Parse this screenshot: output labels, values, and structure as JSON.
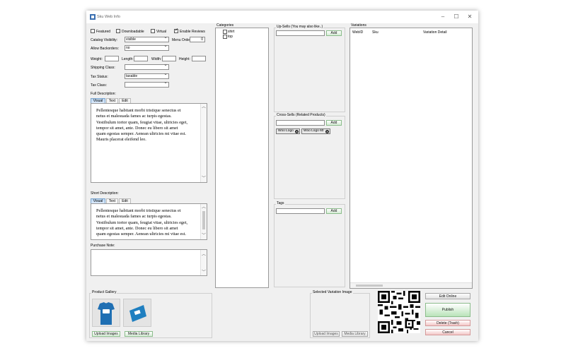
{
  "window": {
    "title": "Sku Web Info",
    "controls": {
      "minimize": "–",
      "maximize": "☐",
      "close": "✕"
    }
  },
  "general": {
    "featured_label": "Featured",
    "featured_checked": false,
    "downloadable_label": "Downloadable",
    "downloadable_checked": false,
    "virtual_label": "Virtual",
    "virtual_checked": false,
    "enable_reviews_label": "Enable Reviews",
    "enable_reviews_checked": true,
    "catalog_visibility_label": "Catalog Visibility:",
    "catalog_visibility_value": "visible",
    "menu_order_label": "Menu Order:",
    "menu_order_value": "0",
    "allow_backorders_label": "Allow Backorders:",
    "allow_backorders_value": "no",
    "weight_label": "Weight:",
    "length_label": "Length:",
    "width_label": "Width:",
    "height_label": "Height:",
    "shipping_class_label": "Shipping Class:",
    "shipping_class_value": "",
    "tax_status_label": "Tax Status:",
    "tax_status_value": "taxable",
    "tax_class_label": "Tax Class:",
    "tax_class_value": ""
  },
  "full_description": {
    "label": "Full Description:",
    "tabs": [
      "Visual",
      "Text",
      "Edit"
    ],
    "lines": [
      "Pellentesque habitant morbi tristique senectus et",
      "netus et malesuada fames ac turpis egestas.",
      "Vestibulum tortor quam, feugiat vitae, ultricies eget,",
      "tempor sit amet, ante. Donec eu libero sit amet",
      "quam egestas semper. Aenean ultricies mi vitae est.",
      "Mauris placerat eleifend leo."
    ]
  },
  "short_description": {
    "label": "Short Description:",
    "tabs": [
      "Visual",
      "Text",
      "Edit"
    ],
    "lines": [
      "Pellentesque habitant morbi tristique senectus et",
      "netus et malesuada fames ac turpis egestas.",
      "Vestibulum tortor quam, feugiat vitae, ultricies eget,",
      "tempor sit amet, ante. Donec eu libero sit amet",
      "quam egestas semper. Aenean ultricies mi vitae est."
    ]
  },
  "purchase_note": {
    "label": "Purchase Note:"
  },
  "categories": {
    "title": "Categories",
    "items": [
      {
        "label": "shirt",
        "checked": false
      },
      {
        "label": "top",
        "checked": false
      }
    ]
  },
  "upsells": {
    "title": "Up-Sells (You may also like..)",
    "add_label": "Add"
  },
  "crosssells": {
    "title": "Cross-Sells (Related Products)",
    "add_label": "Add",
    "tags": [
      {
        "label": "Woo Logo"
      },
      {
        "label": "Woo Logo 60"
      }
    ]
  },
  "tags_group": {
    "title": "Tags",
    "add_label": "Add"
  },
  "variations": {
    "title": "Variations",
    "columns": [
      "WebID",
      "Sku",
      "Variation Detail"
    ]
  },
  "gallery": {
    "title": "Product Gallery",
    "upload_label": "Upload Images",
    "media_label": "Media Library"
  },
  "variation_image": {
    "title": "Selected Variation Image",
    "upload_label": "Upload Images",
    "media_label": "Media Library"
  },
  "actions": {
    "edit_online": "Edit Online",
    "publish": "Publish",
    "delete": "Delete (Trash)",
    "cancel": "Cancel"
  },
  "colors": {
    "green_btn": "#b9e3b9",
    "red_btn": "#f3c6c6",
    "tab_active": "#bcd8f2"
  },
  "icons": {
    "app": "app-icon",
    "qr": "qr-code-icon"
  }
}
